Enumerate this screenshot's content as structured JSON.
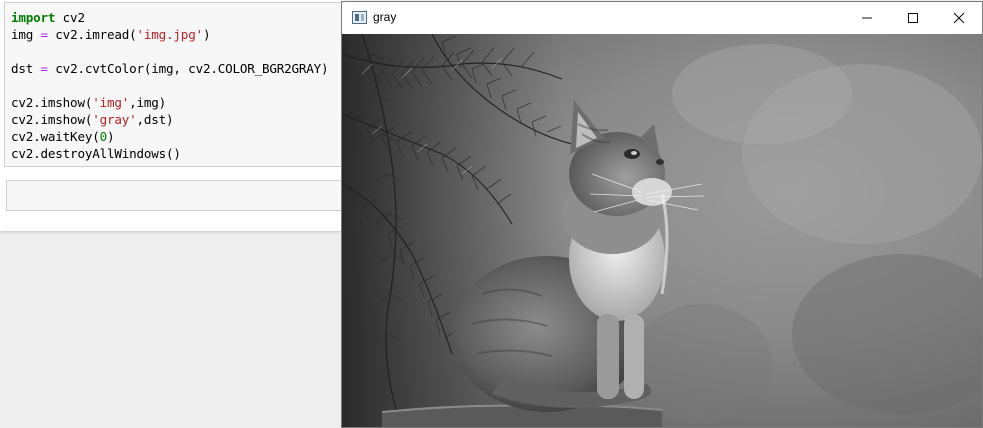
{
  "notebook": {
    "code_lines": [
      {
        "kw": "import",
        "rest": " cv2"
      },
      {
        "a": "img ",
        "op": "=",
        "b": " cv2.imread(",
        "s": "'img.jpg'",
        "c": ")"
      },
      {
        "blank": true
      },
      {
        "a": "dst ",
        "op": "=",
        "b": " cv2.cvtColor(img, cv2.COLOR_BGR2GRAY)"
      },
      {
        "blank": true
      },
      {
        "a": "cv2.imshow(",
        "s": "'img'",
        "b": ",img)"
      },
      {
        "a": "cv2.imshow(",
        "s": "'gray'",
        "b": ",dst)"
      },
      {
        "a": "cv2.waitKey(",
        "n": "0",
        "b": ")"
      },
      {
        "a": "cv2.destroyAllWindows()"
      }
    ]
  },
  "window": {
    "title": "gray",
    "icon": "opencv-window-icon",
    "controls": [
      "minimize-icon",
      "maximize-icon",
      "close-icon"
    ]
  },
  "image": {
    "subject": "grayscale photo of a kitten sitting on a ledge beside pine branches"
  }
}
